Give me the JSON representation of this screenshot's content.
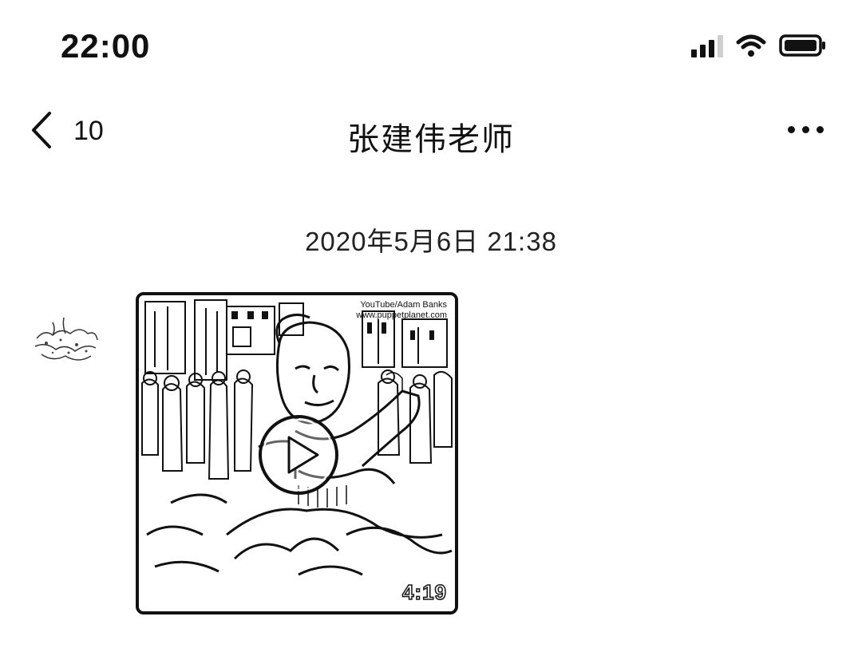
{
  "status_bar": {
    "time": "22:00",
    "icons": [
      "signal-icon",
      "wifi-icon",
      "battery-icon"
    ]
  },
  "nav": {
    "back_icon": "chevron-left-icon",
    "back_count": "10",
    "title": "张建伟老师",
    "more_icon": "more-horizontal-icon"
  },
  "chat": {
    "timestamp": "2020年5月6日 21:38",
    "messages": [
      {
        "type": "video",
        "sender_avatar": "avatar",
        "watermark_lines": [
          "YouTube/Adam Banks",
          "www.puppetplanet.com"
        ],
        "play_icon": "play-icon",
        "duration": "4:19"
      }
    ]
  },
  "colors": {
    "foreground": "#111111",
    "background": "#ffffff"
  }
}
